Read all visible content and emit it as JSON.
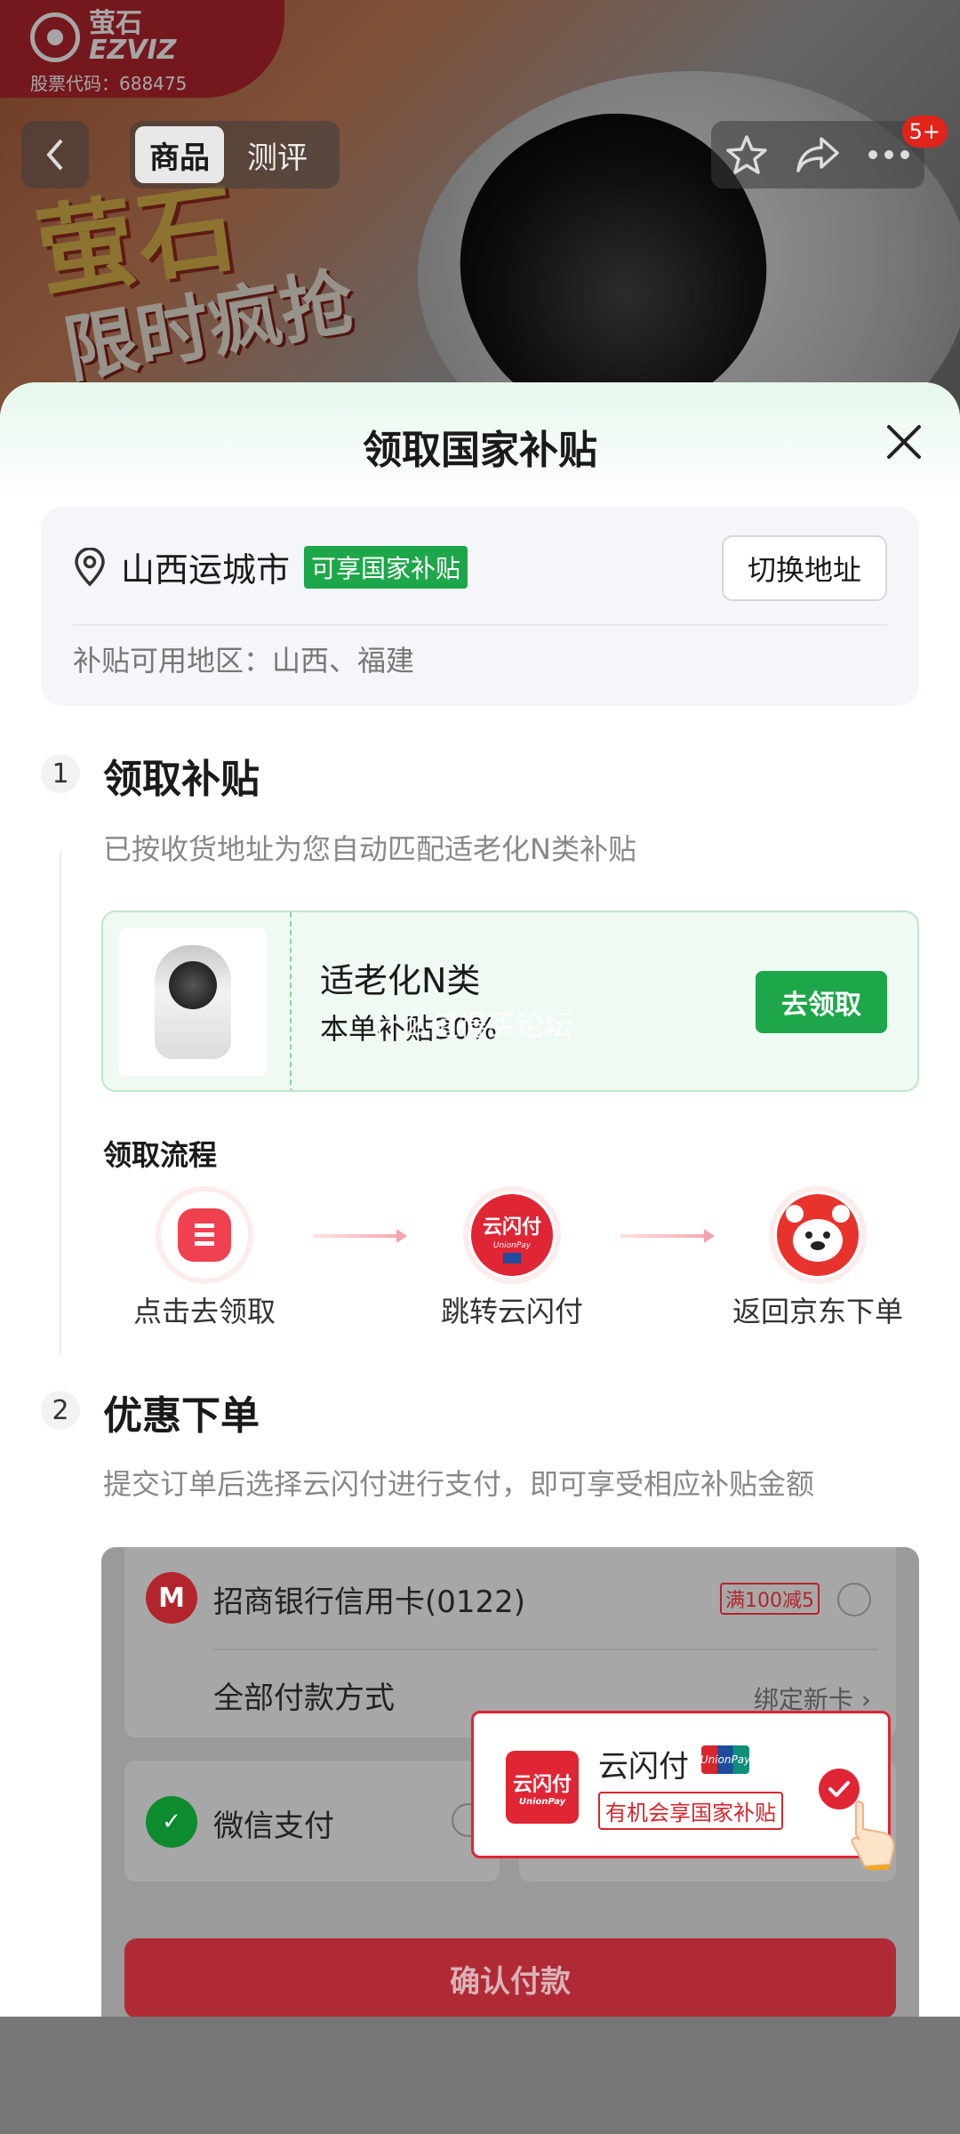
{
  "background": {
    "brand_cn": "萤石",
    "brand_en": "EZVIZ",
    "stock_code": "股票代码：688475",
    "promo_line1": "萤石",
    "promo_line2": "限时疯抢",
    "tabs": [
      {
        "label": "商品",
        "active": true
      },
      {
        "label": "测评",
        "active": false
      }
    ],
    "badge_count": "5+",
    "icons": [
      "back-icon",
      "star-icon",
      "share-icon",
      "more-icon"
    ]
  },
  "sheet": {
    "title": "领取国家补贴",
    "close_icon": "close-icon",
    "address": {
      "city": "山西运城市",
      "eligible_tag": "可享国家补贴",
      "switch_label": "切换地址",
      "regions": "补贴可用地区：山西、福建"
    },
    "step1": {
      "number": "1",
      "title": "领取补贴",
      "desc": "已按收货地址为您自动匹配适老化N类补贴",
      "subsidy": {
        "name": "适老化N类",
        "rate": "本单补贴30%",
        "button": "去领取"
      },
      "flow_title": "领取流程",
      "flow_steps": [
        {
          "label": "点击去领取",
          "icon": "jd-coupon-icon"
        },
        {
          "label": "跳转云闪付",
          "icon": "unionpay-quickpass-icon"
        },
        {
          "label": "返回京东下单",
          "icon": "jd-mascot-icon"
        }
      ]
    },
    "step2": {
      "number": "2",
      "title": "优惠下单",
      "desc": "提交订单后选择云闪付进行支付，即可享受相应补贴金额",
      "payment": {
        "bank_card": "招商银行信用卡(0122)",
        "bank_promo": "满100减5",
        "all_methods": "全部付款方式",
        "bind_card": "绑定新卡 ›",
        "wechat": "微信支付",
        "confirm": "确认付款",
        "ysf_name": "云闪付",
        "ysf_logo": "云闪付",
        "ysf_tag": "有机会享国家补贴",
        "unionpay": "UnionPay"
      }
    }
  },
  "watermark": "什么值得买论坛",
  "colors": {
    "green": "#1ea74a",
    "red": "#e02535",
    "sheet_bg": "#ffffff"
  }
}
